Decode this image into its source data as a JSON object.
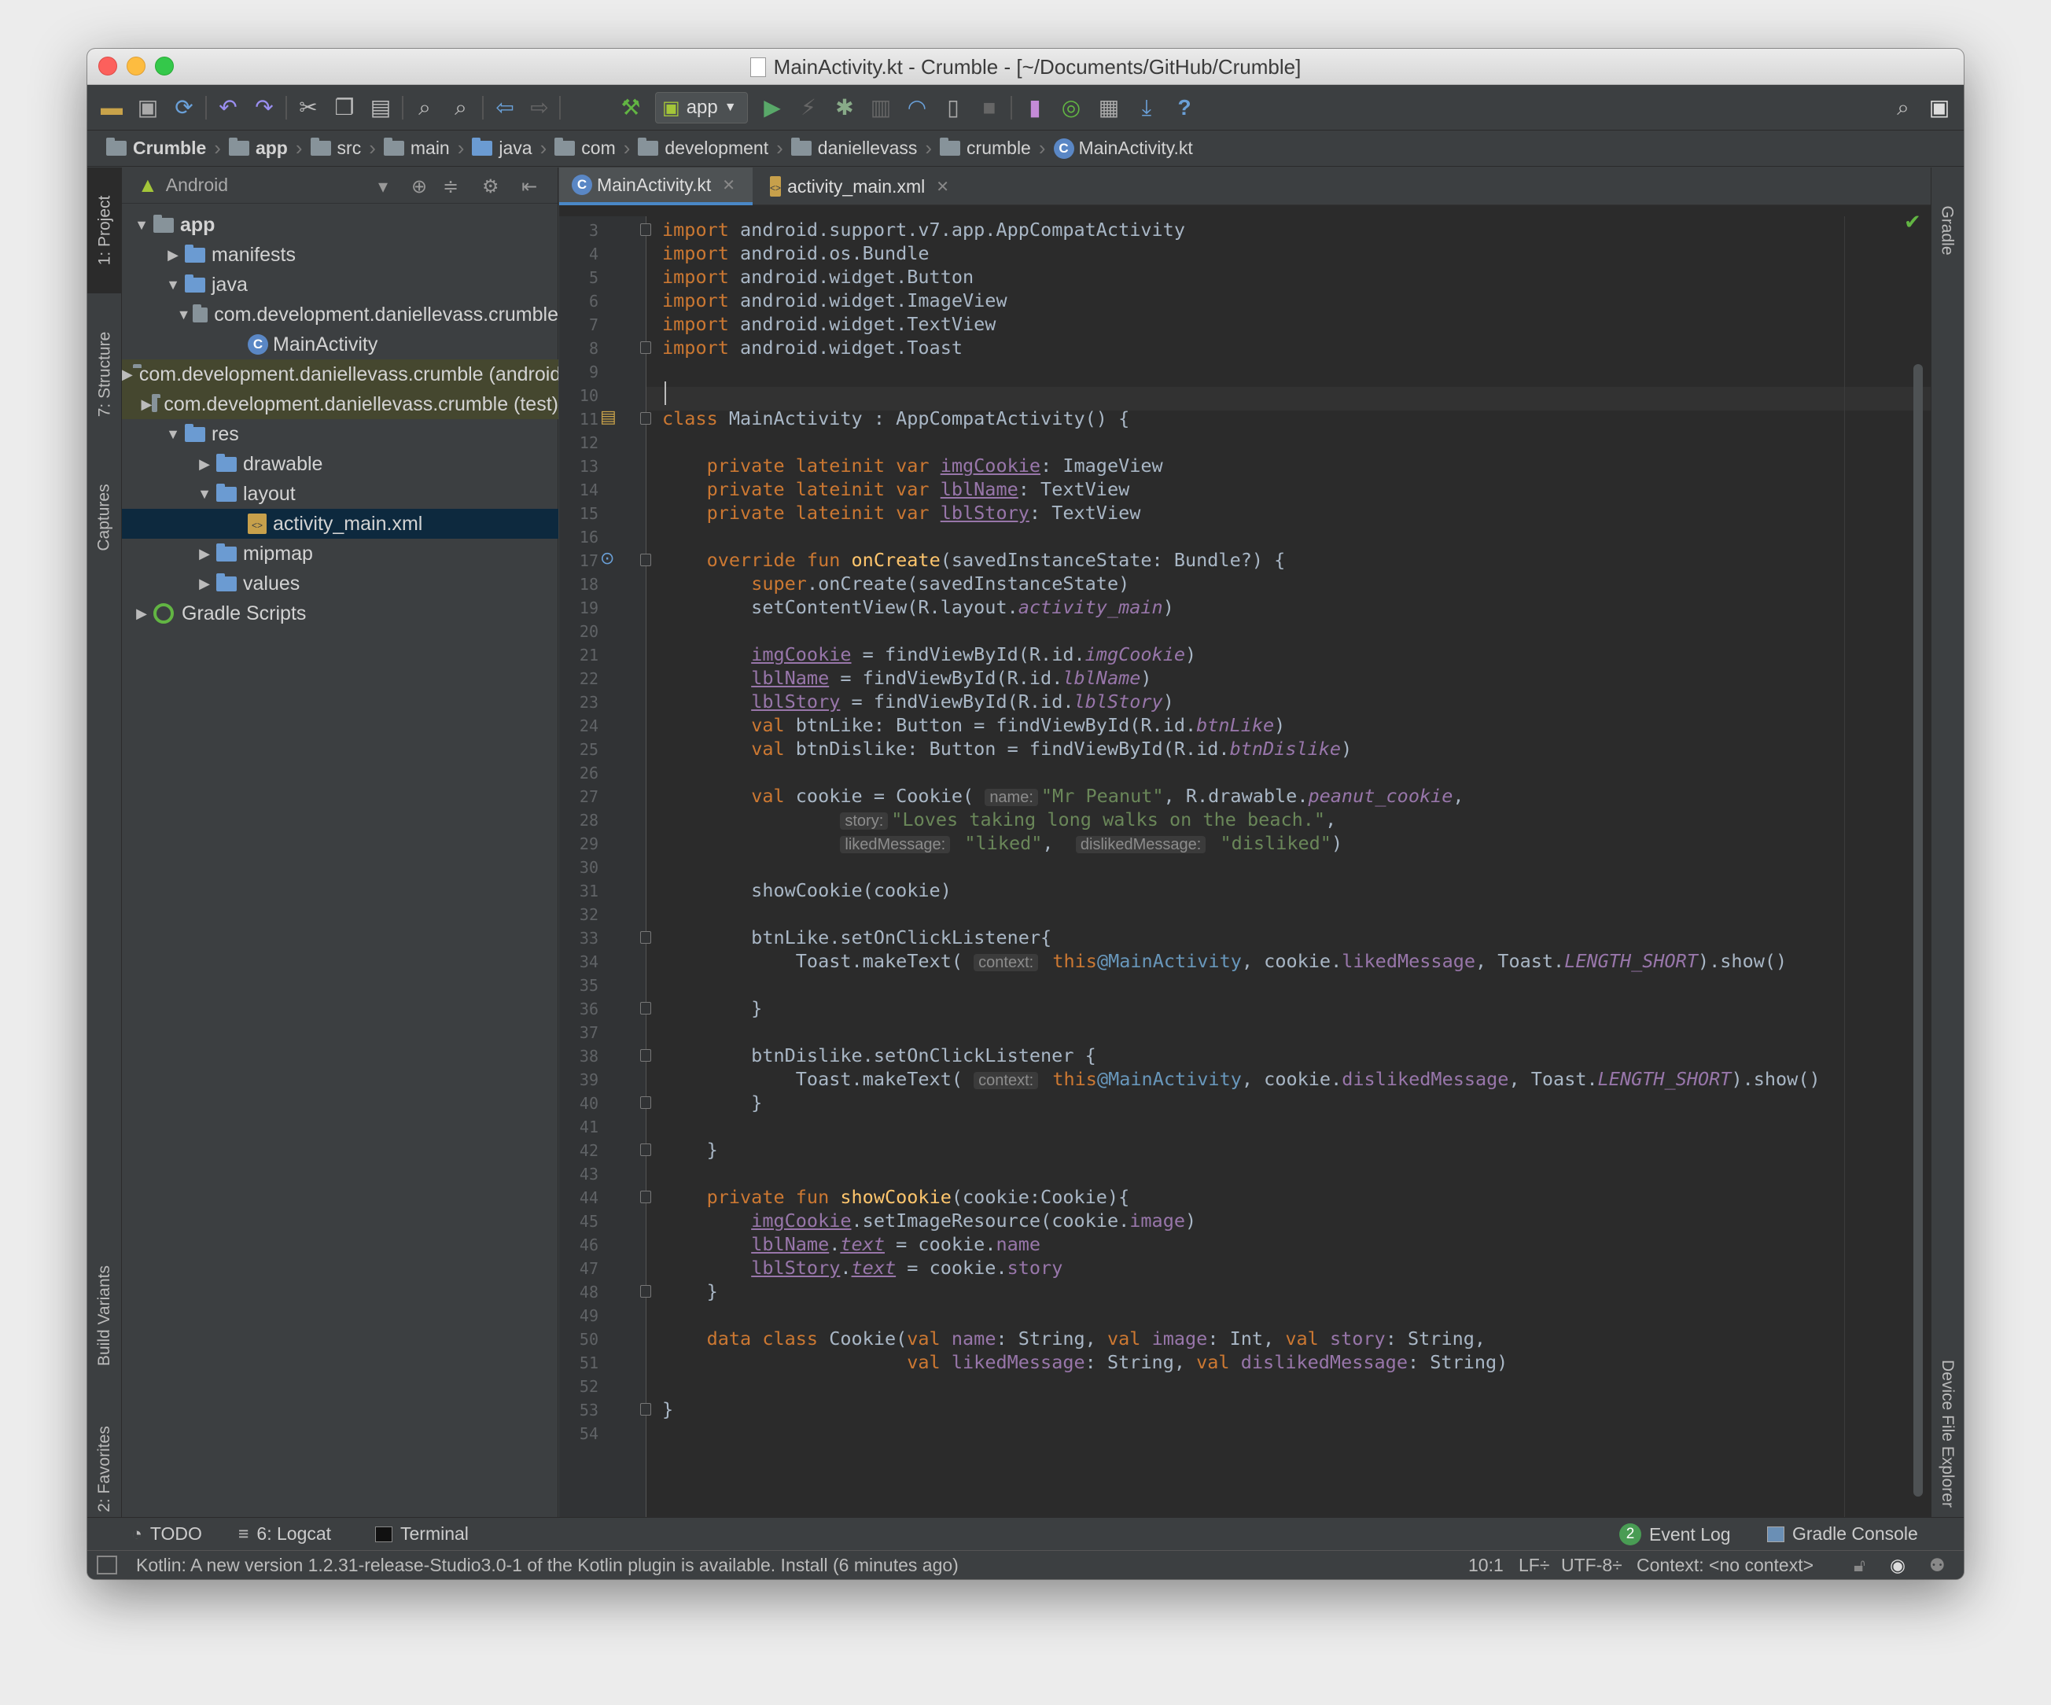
{
  "window": {
    "title": "MainActivity.kt - Crumble - [~/Documents/GitHub/Crumble]"
  },
  "toolbar": {
    "run_config": "app"
  },
  "breadcrumbs": [
    "Crumble",
    "app",
    "src",
    "main",
    "java",
    "com",
    "development",
    "daniellevass",
    "crumble",
    "MainActivity.kt"
  ],
  "left_strip": {
    "project": "1: Project",
    "structure": "7: Structure",
    "captures": "Captures",
    "build_variants": "Build Variants",
    "favorites": "2: Favorites"
  },
  "right_strip": {
    "gradle": "Gradle",
    "device_explorer": "Device File Explorer"
  },
  "project_panel": {
    "view": "Android",
    "tree": [
      {
        "label": "app",
        "depth": 0,
        "arrow": "▼",
        "icon": "module-folder"
      },
      {
        "label": "manifests",
        "depth": 1,
        "arrow": "▶",
        "icon": "folder"
      },
      {
        "label": "java",
        "depth": 1,
        "arrow": "▼",
        "icon": "folder"
      },
      {
        "label": "com.development.daniellevass.crumble",
        "depth": 2,
        "arrow": "▼",
        "icon": "package"
      },
      {
        "label": "MainActivity",
        "depth": 3,
        "arrow": "",
        "icon": "kotlin-class"
      },
      {
        "label": "com.development.daniellevass.crumble (androidTest)",
        "depth": 2,
        "arrow": "▶",
        "icon": "package"
      },
      {
        "label": "com.development.daniellevass.crumble (test)",
        "depth": 2,
        "arrow": "▶",
        "icon": "package"
      },
      {
        "label": "res",
        "depth": 1,
        "arrow": "▼",
        "icon": "folder"
      },
      {
        "label": "drawable",
        "depth": 2,
        "arrow": "▶",
        "icon": "folder"
      },
      {
        "label": "layout",
        "depth": 2,
        "arrow": "▼",
        "icon": "folder"
      },
      {
        "label": "activity_main.xml",
        "depth": 3,
        "arrow": "",
        "icon": "xml"
      },
      {
        "label": "mipmap",
        "depth": 2,
        "arrow": "▶",
        "icon": "folder"
      },
      {
        "label": "values",
        "depth": 2,
        "arrow": "▶",
        "icon": "folder"
      },
      {
        "label": "Gradle Scripts",
        "depth": 0,
        "arrow": "▶",
        "icon": "gradle"
      }
    ]
  },
  "editor": {
    "tabs": [
      {
        "label": "MainActivity.kt",
        "active": true
      },
      {
        "label": "activity_main.xml",
        "active": false
      }
    ],
    "lines": [
      {
        "n": "3",
        "h": "<span class=\"k\">import</span> android.support.v7.app.AppCompatActivity"
      },
      {
        "n": "4",
        "h": "<span class=\"k\">import</span> android.os.Bundle"
      },
      {
        "n": "5",
        "h": "<span class=\"k\">import</span> android.widget.Button"
      },
      {
        "n": "6",
        "h": "<span class=\"k\">import</span> android.widget.ImageView"
      },
      {
        "n": "7",
        "h": "<span class=\"k\">import</span> android.widget.TextView"
      },
      {
        "n": "8",
        "h": "<span class=\"k\">import</span> android.widget.Toast"
      },
      {
        "n": "9",
        "h": ""
      },
      {
        "n": "10",
        "h": ""
      },
      {
        "n": "11",
        "h": "<span class=\"k\">class</span> MainActivity : AppCompatActivity() {"
      },
      {
        "n": "12",
        "h": ""
      },
      {
        "n": "13",
        "h": "    <span class=\"k\">private lateinit var</span> <span class=\"p u\">imgCookie</span>: ImageView"
      },
      {
        "n": "14",
        "h": "    <span class=\"k\">private lateinit var</span> <span class=\"p u\">lblName</span>: TextView"
      },
      {
        "n": "15",
        "h": "    <span class=\"k\">private lateinit var</span> <span class=\"p u\">lblStory</span>: TextView"
      },
      {
        "n": "16",
        "h": ""
      },
      {
        "n": "17",
        "h": "    <span class=\"k\">override fun</span> <span class=\"f\">onCreate</span>(savedInstanceState: Bundle?) {"
      },
      {
        "n": "18",
        "h": "        <span class=\"k\">super</span>.onCreate(savedInstanceState)"
      },
      {
        "n": "19",
        "h": "        setContentView(R.layout.<span class=\"pi\">activity_main</span>)"
      },
      {
        "n": "20",
        "h": ""
      },
      {
        "n": "21",
        "h": "        <span class=\"p u\">imgCookie</span> = findViewById(R.id.<span class=\"pi\">imgCookie</span>)"
      },
      {
        "n": "22",
        "h": "        <span class=\"p u\">lblName</span> = findViewById(R.id.<span class=\"pi\">lblName</span>)"
      },
      {
        "n": "23",
        "h": "        <span class=\"p u\">lblStory</span> = findViewById(R.id.<span class=\"pi\">lblStory</span>)"
      },
      {
        "n": "24",
        "h": "        <span class=\"k\">val</span> btnLike: Button = findViewById(R.id.<span class=\"pi\">btnLike</span>)"
      },
      {
        "n": "25",
        "h": "        <span class=\"k\">val</span> btnDislike: Button = findViewById(R.id.<span class=\"pi\">btnDislike</span>)"
      },
      {
        "n": "26",
        "h": ""
      },
      {
        "n": "27",
        "h": "        <span class=\"k\">val</span> cookie = Cookie( <span class=\"hint\">name:</span><span class=\"s\">\"Mr Peanut\"</span>, R.drawable.<span class=\"pi\">peanut_cookie</span>,"
      },
      {
        "n": "28",
        "h": "                <span class=\"hint\">story:</span><span class=\"s\">\"Loves taking long walks on the beach.\"</span>,"
      },
      {
        "n": "29",
        "h": "                <span class=\"hint\">likedMessage:</span> <span class=\"s\">\"liked\"</span>,  <span class=\"hint\">dislikedMessage:</span> <span class=\"s\">\"disliked\"</span>)"
      },
      {
        "n": "30",
        "h": ""
      },
      {
        "n": "31",
        "h": "        showCookie(cookie)"
      },
      {
        "n": "32",
        "h": ""
      },
      {
        "n": "33",
        "h": "        btnLike.setOnClickListener{"
      },
      {
        "n": "34",
        "h": "            Toast.makeText( <span class=\"hint\">context:</span> <span class=\"k\">this</span><span class=\"lb\">@MainActivity</span>, cookie.<span class=\"p\">likedMessage</span>, Toast.<span class=\"pi\">LENGTH_SHORT</span>).show()"
      },
      {
        "n": "35",
        "h": ""
      },
      {
        "n": "36",
        "h": "        }"
      },
      {
        "n": "37",
        "h": ""
      },
      {
        "n": "38",
        "h": "        btnDislike.setOnClickListener {"
      },
      {
        "n": "39",
        "h": "            Toast.makeText( <span class=\"hint\">context:</span> <span class=\"k\">this</span><span class=\"lb\">@MainActivity</span>, cookie.<span class=\"p\">dislikedMessage</span>, Toast.<span class=\"pi\">LENGTH_SHORT</span>).show()"
      },
      {
        "n": "40",
        "h": "        }"
      },
      {
        "n": "41",
        "h": ""
      },
      {
        "n": "42",
        "h": "    }"
      },
      {
        "n": "43",
        "h": ""
      },
      {
        "n": "44",
        "h": "    <span class=\"k\">private fun</span> <span class=\"f\">showCookie</span>(cookie:Cookie){"
      },
      {
        "n": "45",
        "h": "        <span class=\"p u\">imgCookie</span>.setImageResource(cookie.<span class=\"p\">image</span>)"
      },
      {
        "n": "46",
        "h": "        <span class=\"p u\">lblName</span>.<span class=\"pi u\">text</span> = cookie.<span class=\"p\">name</span>"
      },
      {
        "n": "47",
        "h": "        <span class=\"p u\">lblStory</span>.<span class=\"pi u\">text</span> = cookie.<span class=\"p\">story</span>"
      },
      {
        "n": "48",
        "h": "    }"
      },
      {
        "n": "49",
        "h": ""
      },
      {
        "n": "50",
        "h": "    <span class=\"k\">data class</span> Cookie(<span class=\"k\">val</span> <span class=\"p\">name</span>: String, <span class=\"k\">val</span> <span class=\"p\">image</span>: Int, <span class=\"k\">val</span> <span class=\"p\">story</span>: String,"
      },
      {
        "n": "51",
        "h": "                      <span class=\"k\">val</span> <span class=\"p\">likedMessage</span>: String, <span class=\"k\">val</span> <span class=\"p\">dislikedMessage</span>: String)"
      },
      {
        "n": "52",
        "h": ""
      },
      {
        "n": "53",
        "h": "}"
      },
      {
        "n": "54",
        "h": ""
      }
    ]
  },
  "bottom_tools": {
    "todo": "TODO",
    "logcat": "6: Logcat",
    "terminal": "Terminal",
    "event_log": "Event Log",
    "event_count": "2",
    "gradle_console": "Gradle Console"
  },
  "status": {
    "message": "Kotlin: A new version 1.2.31-release-Studio3.0-1 of the Kotlin plugin is available. Install (6 minutes ago)",
    "position": "10:1",
    "line_sep": "LF÷",
    "encoding": "UTF-8÷",
    "context": "Context: <no context>"
  },
  "colors": {
    "accent": "#4a88c7",
    "keyword": "#cc7832",
    "string": "#6a8759",
    "function": "#ffc66d",
    "property": "#9876aa",
    "background": "#2b2b2b"
  }
}
